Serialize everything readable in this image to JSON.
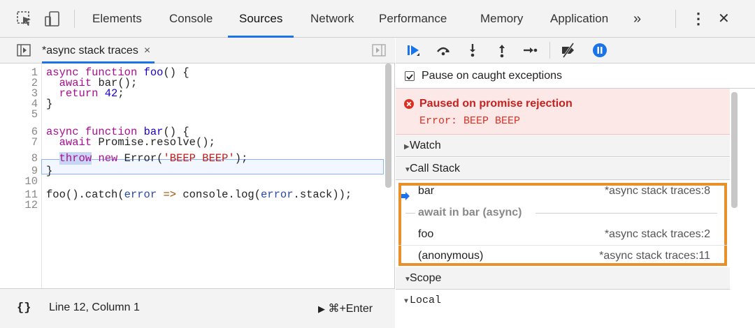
{
  "tabs": [
    "Elements",
    "Console",
    "Sources",
    "Network",
    "Performance",
    "Memory",
    "Application"
  ],
  "active_tab": "Sources",
  "more_tabs": "»",
  "menu_glyph": "⋮",
  "close_glyph": "✕",
  "file_tab": {
    "label": "*async stack traces",
    "close": "×"
  },
  "editor": {
    "line_numbers": [
      "1",
      "2",
      "3",
      "4",
      "5",
      "6",
      "7",
      "8",
      "9",
      "10",
      "11",
      "12"
    ]
  },
  "status": {
    "brace": "{}",
    "position": "Line 12, Column 1",
    "run": "⌘+Enter"
  },
  "pause_on_caught": "Pause on caught exceptions",
  "paused": {
    "title": "Paused on promise rejection",
    "error": "Error: BEEP BEEP"
  },
  "watch_label": "Watch",
  "callstack": {
    "label": "Call Stack",
    "frames": [
      {
        "name": "bar",
        "location": "*async stack traces:8"
      },
      {
        "name": "foo",
        "location": "*async stack traces:2"
      },
      {
        "name": "(anonymous)",
        "location": "*async stack traces:11"
      }
    ],
    "async_label": "await in bar (async)"
  },
  "scope_label": "Scope",
  "local_label": "Local",
  "colors": {
    "accent": "#1a73e8",
    "callstack_highlight": "#e8902a",
    "error_red": "#d93025",
    "paused_bg": "#fde8e8"
  },
  "icons": [
    "inspect-icon",
    "device-toggle-icon",
    "navigator-toggle-icon",
    "debugger-toggle-icon",
    "resume-icon",
    "step-over-icon",
    "step-into-icon",
    "step-out-icon",
    "step-icon",
    "deactivate-breakpoints-icon",
    "pause-on-exceptions-icon",
    "error-icon",
    "current-frame-arrow-icon"
  ]
}
